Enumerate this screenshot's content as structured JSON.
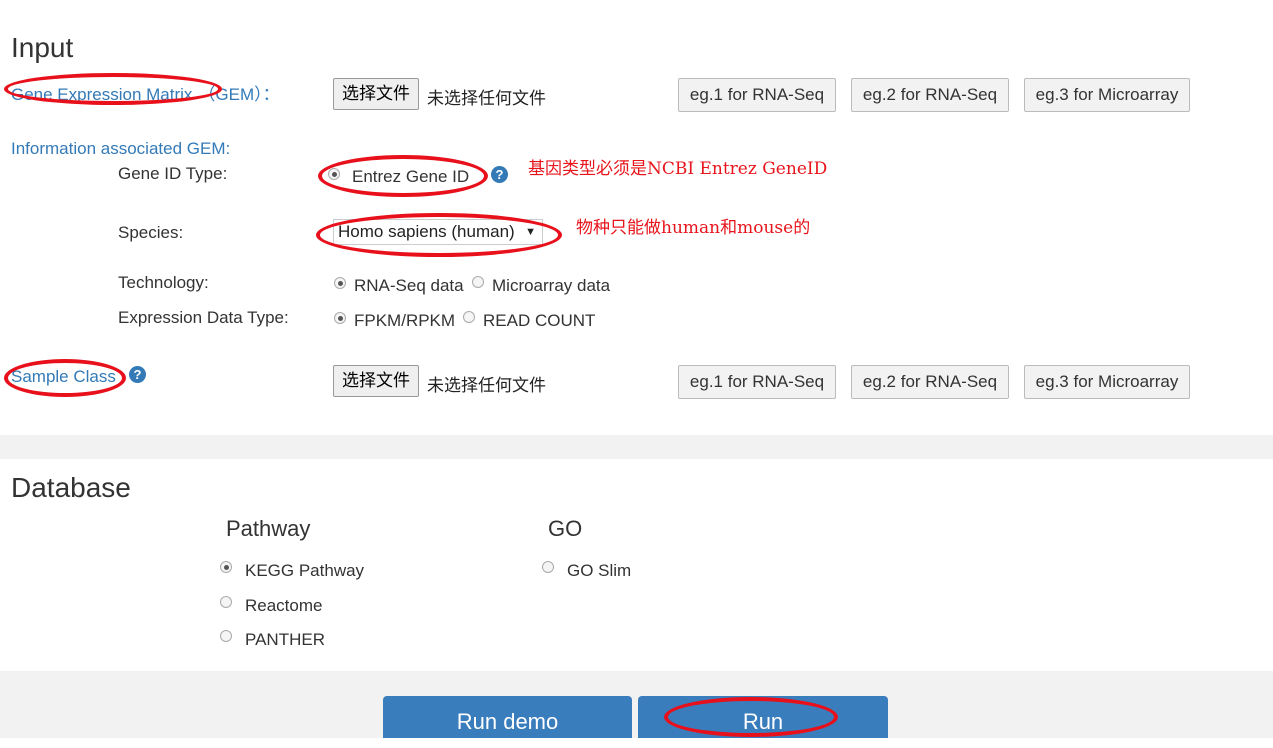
{
  "input": {
    "title": "Input",
    "gem_label_a": "Gene Expression Matrix",
    "gem_label_b": "（GEM）：",
    "file_button": "选择文件",
    "no_file": "未选择任何文件",
    "examples": [
      "eg.1 for RNA-Seq",
      "eg.2 for RNA-Seq",
      "eg.3 for Microarray"
    ],
    "info_label": "Information associated GEM:",
    "gene_id_type_label": "Gene ID Type:",
    "gene_id_option": "Entrez Gene ID",
    "species_label": "Species:",
    "species_value": "Homo sapiens (human)",
    "technology_label": "Technology:",
    "technology_options": [
      "RNA-Seq data",
      "Microarray data"
    ],
    "expr_type_label": "Expression Data Type:",
    "expr_type_options": [
      "FPKM/RPKM",
      "READ COUNT"
    ],
    "sample_class_label": "Sample Class",
    "sample_examples": [
      "eg.1 for RNA-Seq",
      "eg.2 for RNA-Seq",
      "eg.3 for Microarray"
    ]
  },
  "annotations": {
    "gene_id_note": "基因类型必须是NCBI Entrez GeneID",
    "species_note": "物种只能做human和mouse的"
  },
  "database": {
    "title": "Database",
    "pathway_title": "Pathway",
    "pathway_options": [
      "KEGG Pathway",
      "Reactome",
      "PANTHER"
    ],
    "go_title": "GO",
    "go_options": [
      "GO Slim"
    ]
  },
  "actions": {
    "run_demo": "Run demo",
    "run": "Run"
  },
  "colors": {
    "link": "#337ab7",
    "button_primary": "#3a7dbd",
    "annotation_red": "#e8141b"
  },
  "help_icon": "?"
}
